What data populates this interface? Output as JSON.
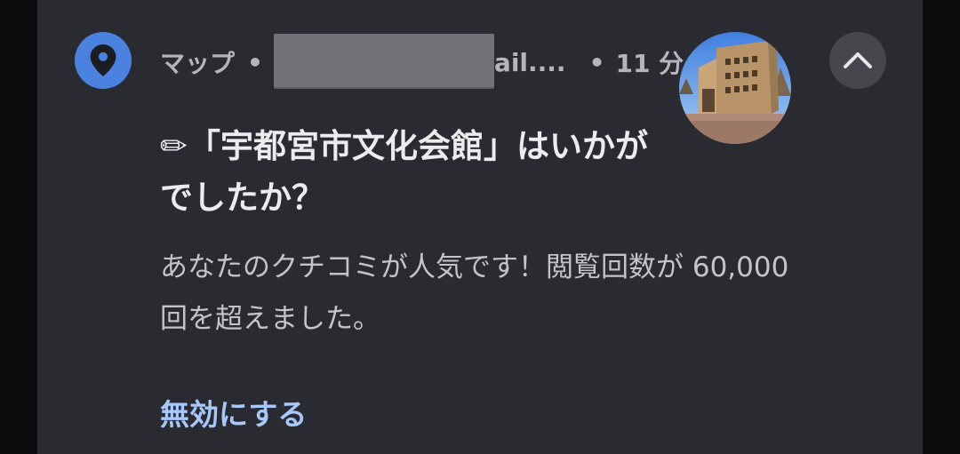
{
  "notification": {
    "app_name": "マップ",
    "separator": "•",
    "account_suffix": "ail....",
    "time_separator": "•",
    "time": "11 分",
    "title": "✏「宇都宮市文化会館」はいかがでしたか？",
    "body": "あなたのクチコミが人気です！閲覧回数が 60,000 回を超えました。",
    "action_label": "無効にする",
    "app_icon": "map-pin-icon",
    "expand_icon": "chevron-up-icon"
  },
  "colors": {
    "card_background": "#2a2b30",
    "app_icon_background": "#4b82e0",
    "action_text": "#a8c7fa"
  }
}
